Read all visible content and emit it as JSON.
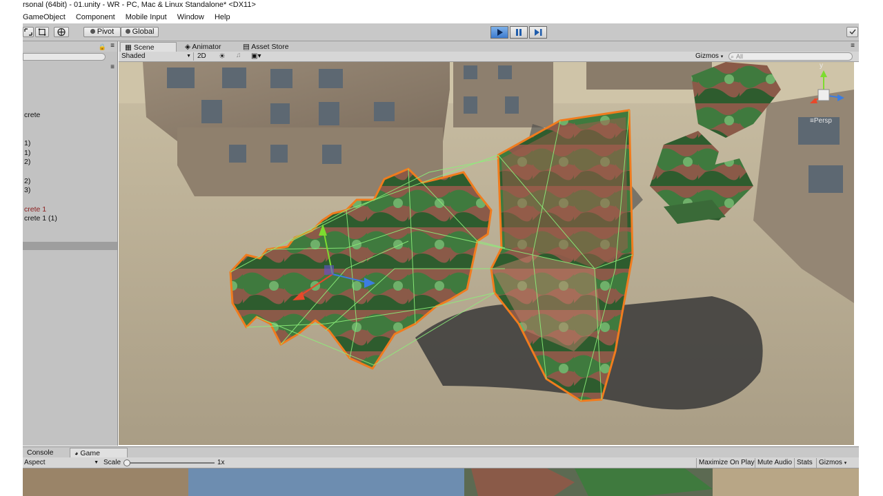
{
  "window": {
    "title": "rsonal (64bit) - 01.unity - WR - PC, Mac & Linux Standalone* <DX11>"
  },
  "menu": [
    "GameObject",
    "Component",
    "Mobile Input",
    "Window",
    "Help"
  ],
  "toolbar": {
    "pivot_label": "Pivot",
    "global_label": "Global"
  },
  "hierarchy": {
    "items": [
      {
        "label": "crete",
        "color": "#111111"
      },
      {
        "label": "1)",
        "color": "#111111"
      },
      {
        "label": "1)",
        "color": "#111111"
      },
      {
        "label": "2)",
        "color": "#111111"
      },
      {
        "label": "2)",
        "color": "#111111"
      },
      {
        "label": "3)",
        "color": "#111111"
      },
      {
        "label": "crete 1",
        "color": "#8b1a1a"
      },
      {
        "label": "crete 1 (1)",
        "color": "#111111"
      }
    ]
  },
  "scene": {
    "tabs": [
      "Scene",
      "Animator",
      "Asset Store"
    ],
    "shading_mode": "Shaded",
    "mode_2d": "2D",
    "gizmos_label": "Gizmos",
    "search_placeholder": "All",
    "persp_label": "Persp",
    "axis_y": "y"
  },
  "bottom": {
    "tabs": [
      "Console",
      "Game"
    ],
    "aspect": "Aspect",
    "scale_label": "Scale",
    "scale_value": "1x",
    "buttons": [
      "Maximize On Play",
      "Mute Audio",
      "Stats",
      "Gizmos"
    ]
  },
  "colors": {
    "play_active": "#3d7bd0",
    "selection_outline": "#f07c1e",
    "collider_wire": "#8cf07a"
  }
}
